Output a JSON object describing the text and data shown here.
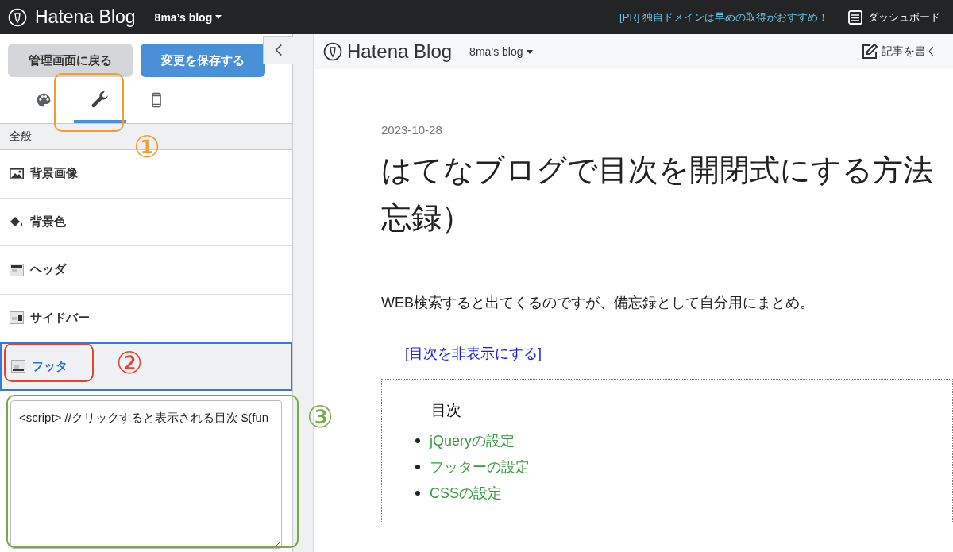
{
  "topbar": {
    "logo": "Hatena Blog",
    "blog_name": "8ma’s blog",
    "promo": "[PR] 独自ドメインは早めの取得がおすすめ！",
    "dashboard": "ダッシュボード"
  },
  "panel": {
    "back_button": "管理画面に戻る",
    "save_button": "変更を保存する",
    "tabs": [
      {
        "kind": "palette",
        "selected": false
      },
      {
        "kind": "wrench",
        "selected": true
      },
      {
        "kind": "phone",
        "selected": false
      }
    ],
    "section": "全般",
    "items": [
      {
        "kind": "image",
        "label": "背景画像",
        "selected": false
      },
      {
        "kind": "paint",
        "label": "背景色",
        "selected": false
      },
      {
        "kind": "header",
        "label": "ヘッダ",
        "selected": false
      },
      {
        "kind": "sidebar",
        "label": "サイドバー",
        "selected": false
      },
      {
        "kind": "footer",
        "label": "フッタ",
        "selected": true
      }
    ],
    "editor_value": "<script> //クリックすると表示される目次 $(fun"
  },
  "preview": {
    "logo": "Hatena Blog",
    "blog_name": "8ma’s blog",
    "write_button": "記事を書く",
    "date": "2023-10-28",
    "title_lines": [
      "はてなブログで目次を開閉式にする方法",
      "忘録）"
    ],
    "paragraph": "WEB検索すると出てくるのですが、備忘録として自分用にまとめ。",
    "toggle_link": "[目次を非表示にする]",
    "toc": {
      "heading": "目次",
      "items": [
        "jQueryの設定",
        "フッターの設定",
        "CSSの設定"
      ]
    }
  },
  "annotations": [
    {
      "label": "①",
      "color": "#f39c34"
    },
    {
      "label": "②",
      "color": "#e8432e"
    },
    {
      "label": "③",
      "color": "#7aa84a"
    }
  ]
}
